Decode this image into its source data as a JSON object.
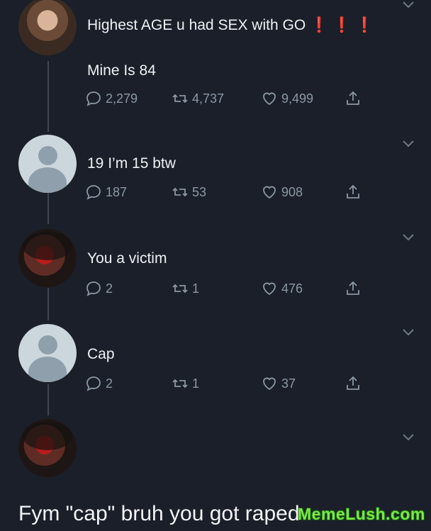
{
  "tweets": [
    {
      "text": "Highest AGE u had SEX with GO",
      "flags": "❗ ❗ ❗",
      "body2": "Mine Is 84",
      "replies": "2,279",
      "retweets": "4,737",
      "likes": "9,499"
    },
    {
      "text": "19 I’m 15 btw",
      "replies": "187",
      "retweets": "53",
      "likes": "908"
    },
    {
      "text": "You a victim",
      "replies": "2",
      "retweets": "1",
      "likes": "476"
    },
    {
      "text": "Cap",
      "replies": "2",
      "retweets": "1",
      "likes": "37"
    }
  ],
  "caption": "Fym \"cap\" bruh you got raped",
  "watermark": "MemeLush.com",
  "colors": {
    "background": "#1b1f29",
    "text": "#eef1f4",
    "muted": "#8b98a5",
    "flag": "#e0242b",
    "watermark": "#7be84a"
  }
}
